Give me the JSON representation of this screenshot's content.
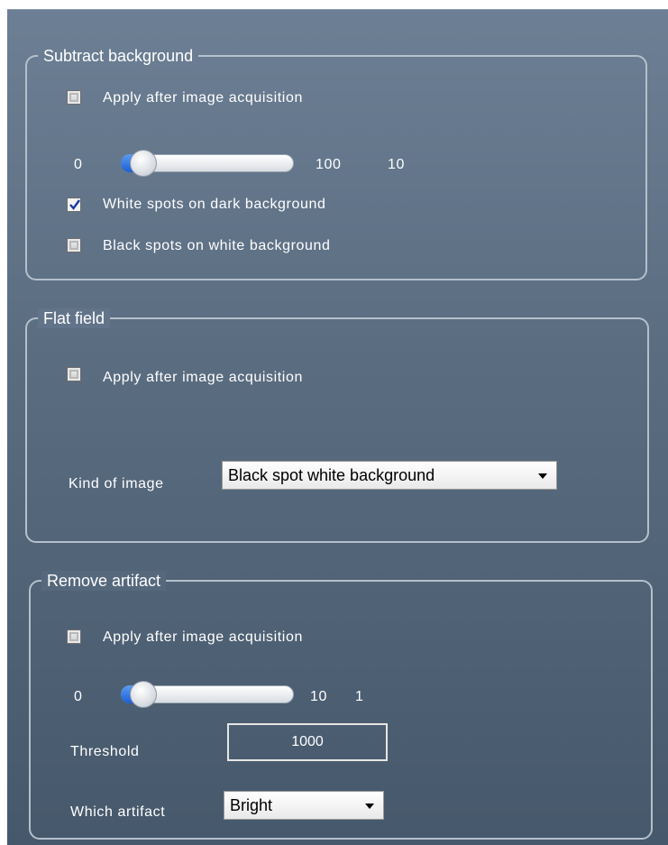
{
  "subtract_background": {
    "title": "Subtract background",
    "apply_label": "Apply after image acquisition",
    "apply_checked": false,
    "slider": {
      "min_label": "0",
      "max_label": "100",
      "value_label": "10",
      "value": 10,
      "max": 100
    },
    "white_spots_label": "White spots on dark background",
    "white_spots_checked": true,
    "black_spots_label": "Black spots on white background",
    "black_spots_checked": false
  },
  "flat_field": {
    "title": "Flat field",
    "apply_label": "Apply after image acquisition",
    "apply_checked": false,
    "kind_label": "Kind of image",
    "kind_value": "Black spot white background"
  },
  "remove_artifact": {
    "title": "Remove artifact",
    "apply_label": "Apply after image acquisition",
    "apply_checked": false,
    "slider": {
      "min_label": "0",
      "max_label": "10",
      "value_label": "1",
      "value": 1,
      "max": 10
    },
    "threshold_label": "Threshold",
    "threshold_value": "1000",
    "which_label": "Which artifact",
    "which_value": "Bright"
  },
  "colors": {
    "accent": "#1c5ed6",
    "panel": "#5b6d81",
    "border": "#b4c0cc"
  },
  "icons": {
    "dropdown": "chevron-down-icon",
    "check": "check-icon"
  }
}
